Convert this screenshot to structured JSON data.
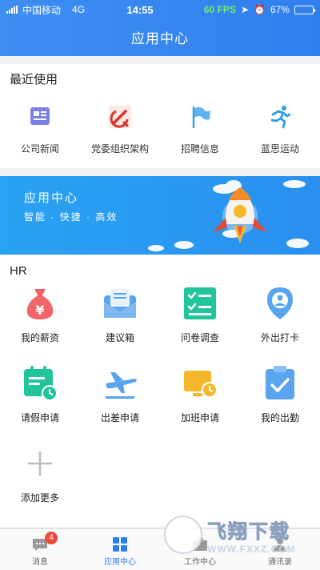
{
  "status_bar": {
    "carrier": "中国移动",
    "network": "4G",
    "time": "14:55",
    "fps": "60 FPS",
    "battery": "67%",
    "battery_level": 0.67
  },
  "header": {
    "title": "应用中心"
  },
  "recent": {
    "title": "最近使用",
    "items": [
      {
        "label": "公司新闻",
        "icon": "news-icon"
      },
      {
        "label": "党委组织架构",
        "icon": "party-emblem-icon"
      },
      {
        "label": "招聘信息",
        "icon": "flag-icon"
      },
      {
        "label": "蓝思运动",
        "icon": "running-icon"
      }
    ]
  },
  "banner": {
    "title": "应用中心",
    "subtitle": "智能 · 快捷 · 高效"
  },
  "hr": {
    "title": "HR",
    "apps": [
      {
        "label": "我的薪资",
        "icon": "money-bag-icon",
        "color": "#f0646a"
      },
      {
        "label": "建议箱",
        "icon": "mailbox-icon",
        "color": "#58a4ee"
      },
      {
        "label": "问卷调查",
        "icon": "survey-checklist-icon",
        "color": "#22c59a"
      },
      {
        "label": "外出打卡",
        "icon": "location-pin-icon",
        "color": "#58a4ee"
      },
      {
        "label": "请假申请",
        "icon": "leave-calendar-icon",
        "color": "#22c59a"
      },
      {
        "label": "出差申请",
        "icon": "airplane-icon",
        "color": "#58a4ee"
      },
      {
        "label": "加班申请",
        "icon": "overtime-monitor-icon",
        "color": "#f5b82a"
      },
      {
        "label": "我的出勤",
        "icon": "attendance-clipboard-icon",
        "color": "#58a4ee"
      },
      {
        "label": "添加更多",
        "icon": "plus-icon",
        "color": "#bbbbbb"
      }
    ]
  },
  "tabbar": {
    "tabs": [
      {
        "label": "消息",
        "icon": "message-icon",
        "badge": "4"
      },
      {
        "label": "应用中心",
        "icon": "apps-grid-icon"
      },
      {
        "label": "工作中心",
        "icon": "work-icon"
      },
      {
        "label": "通讯录",
        "icon": "contacts-icon"
      }
    ],
    "active_color": "#2f7ff0"
  },
  "watermark": {
    "text": "飞翔下载",
    "url": "WWW.FXXZ.COM"
  }
}
